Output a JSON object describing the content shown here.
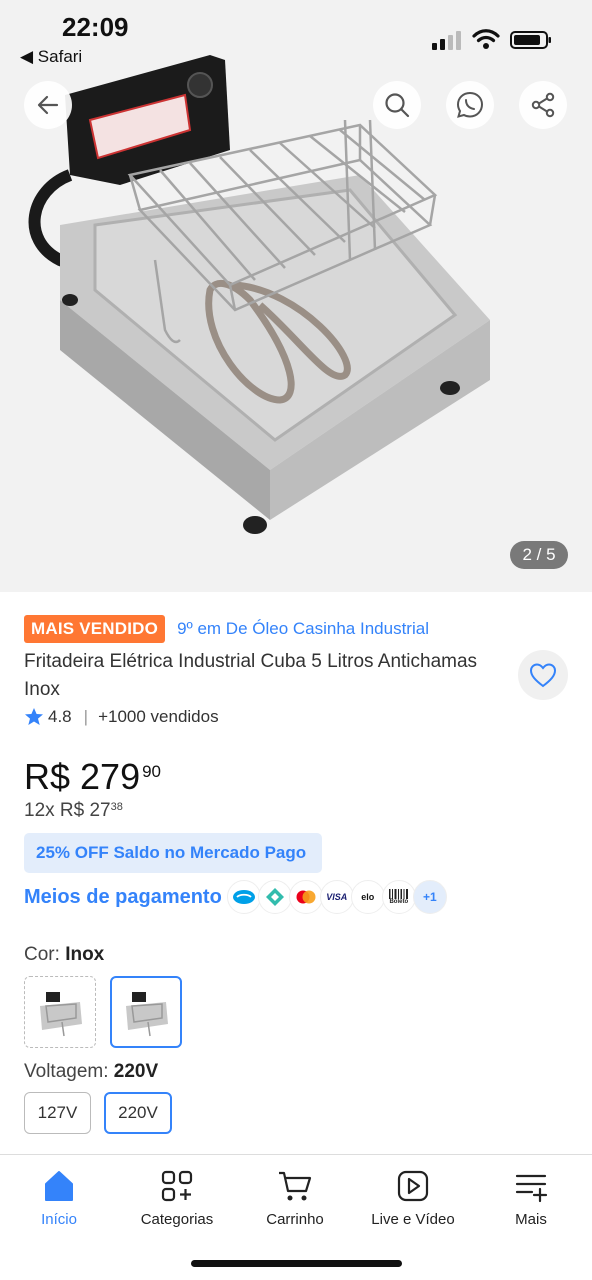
{
  "status_bar": {
    "time": "22:09",
    "back_app": "Safari"
  },
  "gallery": {
    "pager": "2 / 5",
    "icons": [
      "back-arrow-icon",
      "search-icon",
      "whatsapp-icon",
      "share-icon"
    ]
  },
  "product": {
    "badge": "MAIS VENDIDO",
    "rank_link": "9º em De Óleo Casinha Industrial",
    "title": "Fritadeira Elétrica Industrial Cuba 5 Litros Antichamas Inox",
    "rating": "4.8",
    "sold": "+1000 vendidos",
    "price_main": "R$ 279",
    "price_cents": "90",
    "installments_main": "12x R$ 27",
    "installments_cents": "38",
    "promo": "25% OFF Saldo no Mercado Pago",
    "payment_link": "Meios de pagamento",
    "payment_methods": [
      "mercado-pago",
      "pix",
      "mastercard",
      "VISA",
      "elo",
      "Boleto"
    ],
    "payment_more": "+1",
    "color_label": "Cor:",
    "color_value": "Inox",
    "voltage_label": "Voltagem:",
    "voltage_value": "220V",
    "voltage_options": [
      "127V",
      "220V"
    ],
    "selected_voltage": "220V"
  },
  "bottom_nav": {
    "items": [
      {
        "label": "Início",
        "icon": "home-icon",
        "active": true
      },
      {
        "label": "Categorias",
        "icon": "categories-icon",
        "active": false
      },
      {
        "label": "Carrinho",
        "icon": "cart-icon",
        "active": false
      },
      {
        "label": "Live e Vídeo",
        "icon": "play-icon",
        "active": false
      },
      {
        "label": "Mais",
        "icon": "menu-plus-icon",
        "active": false
      }
    ]
  },
  "colors": {
    "accent": "#3483fa",
    "badge": "#ff7733",
    "promo_bg": "#e3edfb"
  }
}
